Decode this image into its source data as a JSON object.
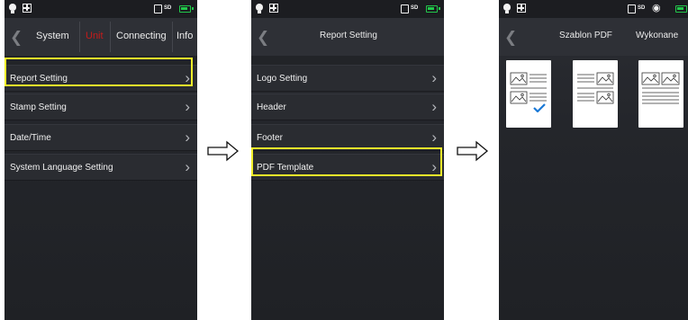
{
  "screens": {
    "system_menu": {
      "tabs": [
        "System",
        "Unit",
        "Connecting",
        "Info"
      ],
      "items": [
        "Report Setting",
        "Stamp Setting",
        "Date/Time",
        "System Language Setting"
      ],
      "highlight_color": "#f2ef2a"
    },
    "report_setting": {
      "title": "Report Setting",
      "items": [
        "Logo Setting",
        "Header",
        "Footer",
        "PDF Template"
      ]
    },
    "pdf_template": {
      "tabs": [
        "Szablon PDF",
        "Wykonane"
      ],
      "template_count": 3,
      "selected_template_index": 0
    }
  },
  "status_bar": {
    "sd_label": "SD",
    "battery_color": "#22c84a",
    "icons": [
      "bulb-icon",
      "grid-icon",
      "sd-card-icon",
      "wifi-icon",
      "battery-icon"
    ]
  },
  "colors": {
    "background": "#24262b",
    "text": "#f1f1f1",
    "accent_red": "#c61b1b",
    "highlight": "#f2ef2a"
  }
}
